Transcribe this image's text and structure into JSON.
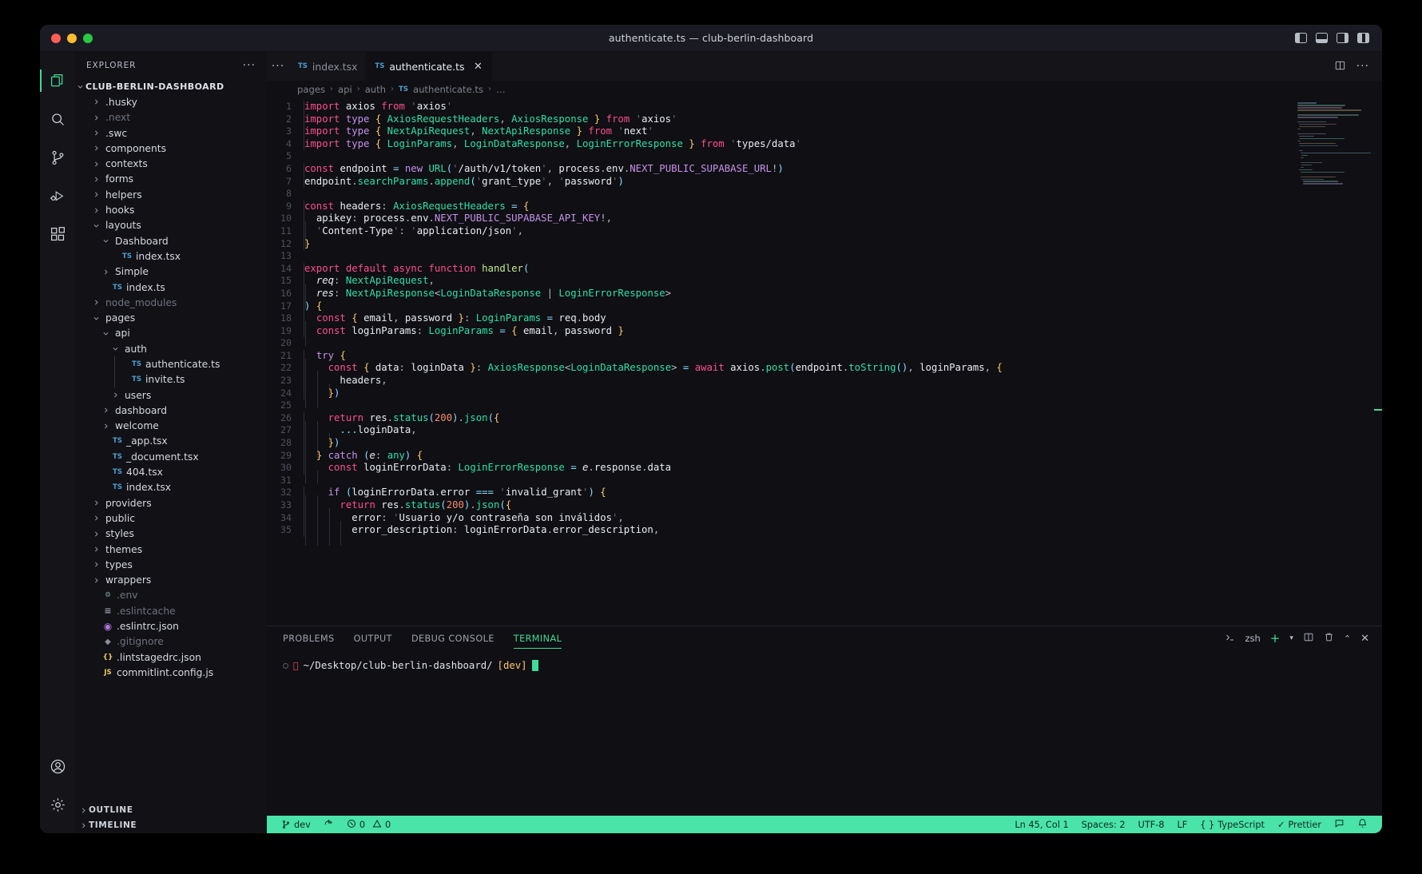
{
  "window": {
    "title": "authenticate.ts — club-berlin-dashboard",
    "traffic": [
      "close",
      "minimize",
      "maximize"
    ]
  },
  "activitybar": {
    "items": [
      {
        "name": "explorer",
        "icon": "files-icon",
        "active": true
      },
      {
        "name": "search",
        "icon": "search-icon",
        "active": false
      },
      {
        "name": "source-control",
        "icon": "source-control-icon",
        "active": false
      },
      {
        "name": "run-debug",
        "icon": "run-debug-icon",
        "active": false
      },
      {
        "name": "extensions",
        "icon": "extensions-icon",
        "active": false
      }
    ],
    "bottom": [
      {
        "name": "accounts",
        "icon": "account-icon"
      },
      {
        "name": "settings",
        "icon": "gear-icon"
      }
    ]
  },
  "sidebar": {
    "header": "EXPLORER",
    "more": "···",
    "root": "CLUB-BERLIN-DASHBOARD",
    "items": [
      {
        "label": ".husky",
        "indent": 1,
        "kind": "folder",
        "state": "collapsed"
      },
      {
        "label": ".next",
        "indent": 1,
        "kind": "folder",
        "state": "collapsed",
        "dim": true
      },
      {
        "label": ".swc",
        "indent": 1,
        "kind": "folder",
        "state": "collapsed"
      },
      {
        "label": "components",
        "indent": 1,
        "kind": "folder",
        "state": "collapsed"
      },
      {
        "label": "contexts",
        "indent": 1,
        "kind": "folder",
        "state": "collapsed"
      },
      {
        "label": "forms",
        "indent": 1,
        "kind": "folder",
        "state": "collapsed"
      },
      {
        "label": "helpers",
        "indent": 1,
        "kind": "folder",
        "state": "collapsed"
      },
      {
        "label": "hooks",
        "indent": 1,
        "kind": "folder",
        "state": "collapsed"
      },
      {
        "label": "layouts",
        "indent": 1,
        "kind": "folder",
        "state": "expanded"
      },
      {
        "label": "Dashboard",
        "indent": 2,
        "kind": "folder",
        "state": "expanded"
      },
      {
        "label": "index.tsx",
        "indent": 3,
        "kind": "ts"
      },
      {
        "label": "Simple",
        "indent": 2,
        "kind": "folder",
        "state": "collapsed"
      },
      {
        "label": "index.ts",
        "indent": 2,
        "kind": "ts"
      },
      {
        "label": "node_modules",
        "indent": 1,
        "kind": "folder",
        "state": "collapsed",
        "dim": true
      },
      {
        "label": "pages",
        "indent": 1,
        "kind": "folder",
        "state": "expanded"
      },
      {
        "label": "api",
        "indent": 2,
        "kind": "folder",
        "state": "expanded"
      },
      {
        "label": "auth",
        "indent": 3,
        "kind": "folder",
        "state": "expanded"
      },
      {
        "label": "authenticate.ts",
        "indent": 4,
        "kind": "ts",
        "guide": true
      },
      {
        "label": "invite.ts",
        "indent": 4,
        "kind": "ts",
        "guide": true
      },
      {
        "label": "users",
        "indent": 3,
        "kind": "folder",
        "state": "collapsed"
      },
      {
        "label": "dashboard",
        "indent": 2,
        "kind": "folder",
        "state": "collapsed"
      },
      {
        "label": "welcome",
        "indent": 2,
        "kind": "folder",
        "state": "collapsed"
      },
      {
        "label": "_app.tsx",
        "indent": 2,
        "kind": "ts"
      },
      {
        "label": "_document.tsx",
        "indent": 2,
        "kind": "ts"
      },
      {
        "label": "404.tsx",
        "indent": 2,
        "kind": "ts"
      },
      {
        "label": "index.tsx",
        "indent": 2,
        "kind": "ts"
      },
      {
        "label": "providers",
        "indent": 1,
        "kind": "folder",
        "state": "collapsed"
      },
      {
        "label": "public",
        "indent": 1,
        "kind": "folder",
        "state": "collapsed"
      },
      {
        "label": "styles",
        "indent": 1,
        "kind": "folder",
        "state": "collapsed"
      },
      {
        "label": "themes",
        "indent": 1,
        "kind": "folder",
        "state": "collapsed"
      },
      {
        "label": "types",
        "indent": 1,
        "kind": "folder",
        "state": "collapsed"
      },
      {
        "label": "wrappers",
        "indent": 1,
        "kind": "folder",
        "state": "collapsed"
      },
      {
        "label": ".env",
        "indent": 1,
        "kind": "env",
        "dim": true
      },
      {
        "label": ".eslintcache",
        "indent": 1,
        "kind": "list",
        "dim": true
      },
      {
        "label": ".eslintrc.json",
        "indent": 1,
        "kind": "eslint"
      },
      {
        "label": ".gitignore",
        "indent": 1,
        "kind": "git",
        "dim": true
      },
      {
        "label": ".lintstagedrc.json",
        "indent": 1,
        "kind": "json"
      },
      {
        "label": "commitlint.config.js",
        "indent": 1,
        "kind": "js"
      }
    ],
    "sections": [
      {
        "label": "OUTLINE",
        "state": "collapsed"
      },
      {
        "label": "TIMELINE",
        "state": "collapsed"
      }
    ]
  },
  "tabs": {
    "more": "···",
    "items": [
      {
        "label": "index.tsx",
        "icon": "TS",
        "active": false,
        "close": ""
      },
      {
        "label": "authenticate.ts",
        "icon": "TS",
        "active": true,
        "close": "✕"
      }
    ]
  },
  "breadcrumb": {
    "items": [
      "pages",
      "api",
      "auth",
      "authenticate.ts",
      "…"
    ],
    "file_icon": "TS",
    "separator": "›"
  },
  "editor": {
    "file": "authenticate.ts",
    "first_line": 1,
    "lines": [
      {
        "n": 1,
        "text": "import axios from 'axios'"
      },
      {
        "n": 2,
        "text": "import type { AxiosRequestHeaders, AxiosResponse } from 'axios'"
      },
      {
        "n": 3,
        "text": "import type { NextApiRequest, NextApiResponse } from 'next'"
      },
      {
        "n": 4,
        "text": "import type { LoginParams, LoginDataResponse, LoginErrorResponse } from 'types/data'"
      },
      {
        "n": 5,
        "text": ""
      },
      {
        "n": 6,
        "text": "const endpoint = new URL('/auth/v1/token', process.env.NEXT_PUBLIC_SUPABASE_URL!)"
      },
      {
        "n": 7,
        "text": "endpoint.searchParams.append('grant_type', 'password')"
      },
      {
        "n": 8,
        "text": ""
      },
      {
        "n": 9,
        "text": "const headers: AxiosRequestHeaders = {"
      },
      {
        "n": 10,
        "text": "  apikey: process.env.NEXT_PUBLIC_SUPABASE_API_KEY!,"
      },
      {
        "n": 11,
        "text": "  'Content-Type': 'application/json',"
      },
      {
        "n": 12,
        "text": "}"
      },
      {
        "n": 13,
        "text": ""
      },
      {
        "n": 14,
        "text": "export default async function handler("
      },
      {
        "n": 15,
        "text": "  req: NextApiRequest,"
      },
      {
        "n": 16,
        "text": "  res: NextApiResponse<LoginDataResponse | LoginErrorResponse>"
      },
      {
        "n": 17,
        "text": ") {"
      },
      {
        "n": 18,
        "text": "  const { email, password }: LoginParams = req.body"
      },
      {
        "n": 19,
        "text": "  const loginParams: LoginParams = { email, password }"
      },
      {
        "n": 20,
        "text": ""
      },
      {
        "n": 21,
        "text": "  try {"
      },
      {
        "n": 22,
        "text": "    const { data: loginData }: AxiosResponse<LoginDataResponse> = await axios.post(endpoint.toString(), loginParams, {"
      },
      {
        "n": 23,
        "text": "      headers,"
      },
      {
        "n": 24,
        "text": "    })"
      },
      {
        "n": 25,
        "text": ""
      },
      {
        "n": 26,
        "text": "    return res.status(200).json({"
      },
      {
        "n": 27,
        "text": "      ...loginData,"
      },
      {
        "n": 28,
        "text": "    })"
      },
      {
        "n": 29,
        "text": "  } catch (e: any) {"
      },
      {
        "n": 30,
        "text": "    const loginErrorData: LoginErrorResponse = e.response.data"
      },
      {
        "n": 31,
        "text": ""
      },
      {
        "n": 32,
        "text": "    if (loginErrorData.error === 'invalid_grant') {"
      },
      {
        "n": 33,
        "text": "      return res.status(200).json({"
      },
      {
        "n": 34,
        "text": "        error: 'Usuario y/o contraseña son inválidos',"
      },
      {
        "n": 35,
        "text": "        error_description: loginErrorData.error_description,"
      }
    ]
  },
  "panel": {
    "tabs": [
      {
        "label": "PROBLEMS",
        "active": false
      },
      {
        "label": "OUTPUT",
        "active": false
      },
      {
        "label": "DEBUG CONSOLE",
        "active": false
      },
      {
        "label": "TERMINAL",
        "active": true
      }
    ],
    "shell": "zsh",
    "actions": [
      "new-terminal",
      "split-terminal",
      "kill-terminal",
      "maximize-panel",
      "close-panel"
    ],
    "terminal": {
      "prompt_path": "~/Desktop/club-berlin-dashboard/",
      "branch": "[dev]",
      "cursor": true
    }
  },
  "statusbar": {
    "branch": "dev",
    "sync": "sync-icon",
    "errors": "0",
    "warnings": "0",
    "position": "Ln 45, Col 1",
    "indent": "Spaces: 2",
    "encoding": "UTF-8",
    "eol": "LF",
    "language": "TypeScript",
    "formatter": "Prettier",
    "feedback": "feedback-icon",
    "bell": "bell-icon"
  },
  "colors": {
    "accent": "#3ddc97",
    "statusbar_bg": "#4ae3a8",
    "editor_bg": "#0f0f14",
    "sidebar_bg": "#111116"
  }
}
